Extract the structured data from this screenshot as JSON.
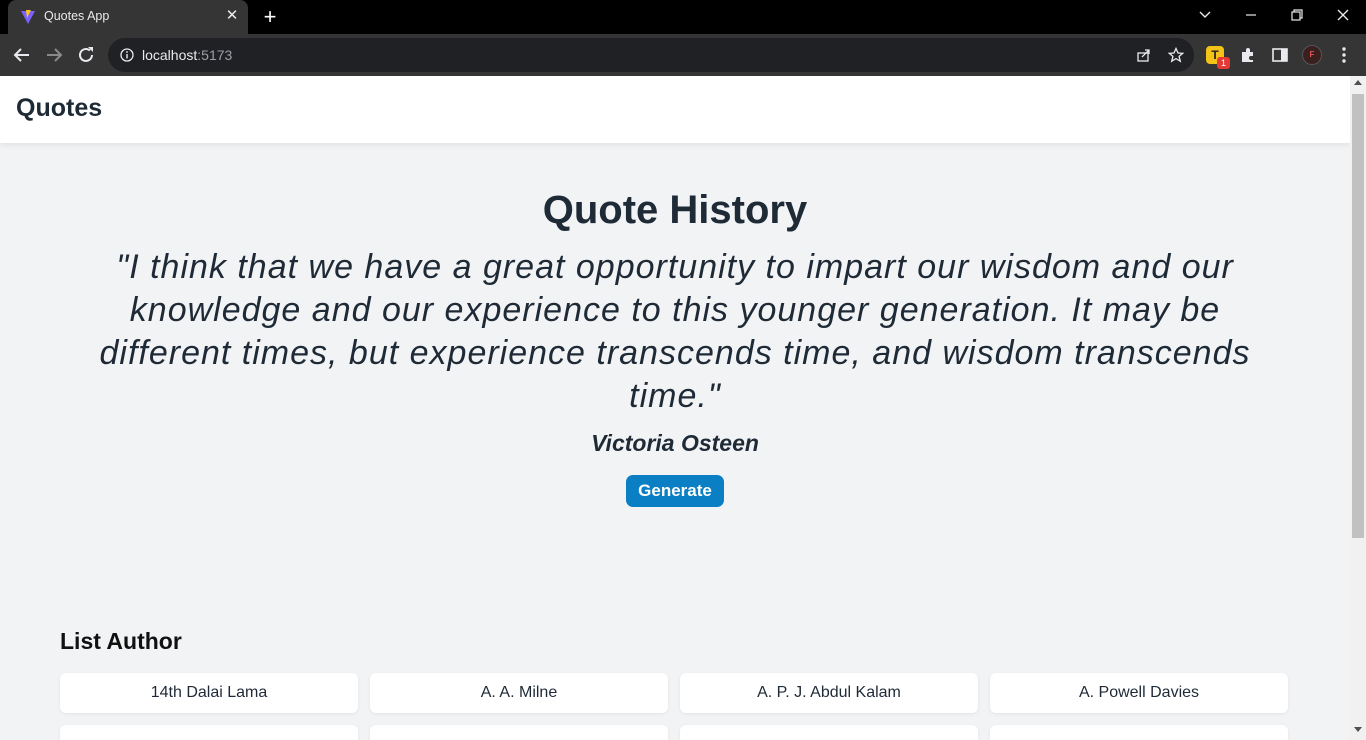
{
  "browser": {
    "tab_title": "Quotes App",
    "url_host": "localhost",
    "url_port": ":5173",
    "extension_letter": "T",
    "extension_badge": "1",
    "profile_initial": "F"
  },
  "header": {
    "brand": "Quotes"
  },
  "hero": {
    "title": "Quote History",
    "quote": "\"I think that we have a great opportunity to impart our wisdom and our knowledge and our experience to this younger generation. It may be different times, but experience transcends time, and wisdom transcends time.\"",
    "author": "Victoria Osteen",
    "generate_label": "Generate"
  },
  "authors": {
    "title": "List Author",
    "items": [
      "14th Dalai Lama",
      "A. A. Milne",
      "A. P. J. Abdul Kalam",
      "A. Powell Davies",
      "",
      "",
      "",
      ""
    ]
  },
  "colors": {
    "accent": "#0a7fc3",
    "text": "#1f2a37",
    "page_bg": "#f2f3f5"
  }
}
